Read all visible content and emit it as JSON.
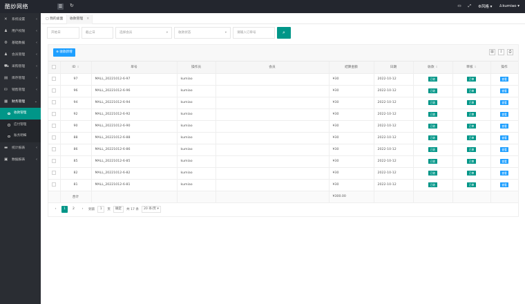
{
  "app": {
    "logo": "酷妙网络",
    "user": "kumiao",
    "language": "风格"
  },
  "sidebar": {
    "items": [
      {
        "label": "系统设置",
        "icon": "settings-icon"
      },
      {
        "label": "用户权限",
        "icon": "users-icon"
      },
      {
        "label": "基础数据",
        "icon": "gear-icon"
      },
      {
        "label": "会员管理",
        "icon": "user-icon"
      },
      {
        "label": "采购管理",
        "icon": "cart-icon"
      },
      {
        "label": "库存管理",
        "icon": "box-icon"
      },
      {
        "label": "销售管理",
        "icon": "sale-icon"
      },
      {
        "label": "财务管理",
        "icon": "finance-icon"
      }
    ],
    "sub_items": [
      {
        "label": "收款管理",
        "active": true
      },
      {
        "label": "应付管理",
        "active": false
      },
      {
        "label": "账务明细",
        "active": false
      }
    ],
    "bottom_items": [
      {
        "label": "统计报表",
        "icon": "chart-icon"
      },
      {
        "label": "数据报表",
        "icon": "report-icon"
      }
    ]
  },
  "tabs": {
    "home": "我的桌面",
    "current": "收款管理"
  },
  "filters": {
    "start_date": "开始日",
    "end_date": "截止日",
    "operator": "选择会员",
    "status": "收款状态",
    "order_no": "请输入订单号"
  },
  "toolbar": {
    "add_label": "收款新增"
  },
  "table": {
    "headers": [
      "ID",
      "单号",
      "操作员",
      "会员",
      "结算金额",
      "日期",
      "收款",
      "审核",
      "操作"
    ],
    "rows": [
      {
        "id": "97",
        "no": "MALL_20221012-6-97",
        "operator": "kumiao",
        "member": "",
        "amount": "¥30",
        "date": "2022-10-12",
        "received": "已收",
        "audit": "已审",
        "action": "查看"
      },
      {
        "id": "96",
        "no": "MALL_20221012-6-96",
        "operator": "kumiao",
        "member": "",
        "amount": "¥30",
        "date": "2022-10-12",
        "received": "已收",
        "audit": "已审",
        "action": "查看"
      },
      {
        "id": "94",
        "no": "MALL_20221012-6-94",
        "operator": "kumiao",
        "member": "",
        "amount": "¥30",
        "date": "2022-10-12",
        "received": "已收",
        "audit": "已审",
        "action": "查看"
      },
      {
        "id": "92",
        "no": "MALL_20221012-6-92",
        "operator": "kumiao",
        "member": "",
        "amount": "¥30",
        "date": "2022-10-12",
        "received": "已收",
        "audit": "已审",
        "action": "查看"
      },
      {
        "id": "90",
        "no": "MALL_20221012-6-90",
        "operator": "kumiao",
        "member": "",
        "amount": "¥30",
        "date": "2022-10-12",
        "received": "已收",
        "audit": "已审",
        "action": "查看"
      },
      {
        "id": "88",
        "no": "MALL_20221012-6-88",
        "operator": "kumiao",
        "member": "",
        "amount": "¥30",
        "date": "2022-10-12",
        "received": "已收",
        "audit": "已审",
        "action": "查看"
      },
      {
        "id": "86",
        "no": "MALL_20221012-6-86",
        "operator": "kumiao",
        "member": "",
        "amount": "¥30",
        "date": "2022-10-12",
        "received": "已收",
        "audit": "已审",
        "action": "查看"
      },
      {
        "id": "85",
        "no": "MALL_20221012-6-85",
        "operator": "kumiao",
        "member": "",
        "amount": "¥30",
        "date": "2022-10-12",
        "received": "已收",
        "audit": "已审",
        "action": "查看"
      },
      {
        "id": "82",
        "no": "MALL_20221012-6-82",
        "operator": "kumiao",
        "member": "",
        "amount": "¥30",
        "date": "2022-10-12",
        "received": "已收",
        "audit": "已审",
        "action": "查看"
      },
      {
        "id": "81",
        "no": "MALL_20221012-6-81",
        "operator": "kumiao",
        "member": "",
        "amount": "¥30",
        "date": "2022-10-12",
        "received": "已收",
        "audit": "已审",
        "action": "查看"
      }
    ],
    "total_label": "合计",
    "total_amount": "¥300.00"
  },
  "pager": {
    "pages": [
      "1",
      "2"
    ],
    "goto_label": "到第",
    "goto_value": "1",
    "page_unit": "页",
    "confirm": "确定",
    "total": "共 17 条",
    "page_size": "20 条/页"
  },
  "colors": {
    "accent": "#009688",
    "blue": "#1e9fff",
    "topbar": "#23262e",
    "sidebar": "#2a2d33"
  }
}
